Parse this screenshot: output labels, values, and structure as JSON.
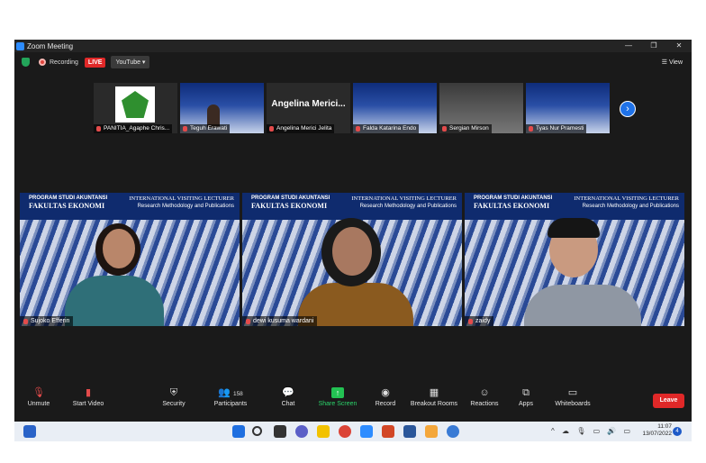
{
  "window": {
    "title": "Zoom Meeting",
    "minimize": "—",
    "restore": "❐",
    "close": "✕"
  },
  "status": {
    "recording": "Recording",
    "live": "LIVE",
    "stream": "YouTube ▾",
    "view": "View"
  },
  "thumbnails": [
    {
      "name": "PANITIA_Agaphe Chris..."
    },
    {
      "name": "Teguh Erawati"
    },
    {
      "name": "Angelina Merici Jelita",
      "display_name": "Angelina Merici..."
    },
    {
      "name": "Falda Katarina Endo"
    },
    {
      "name": "Sergian Mirson"
    },
    {
      "name": "Tyas Nur Pramesti"
    }
  ],
  "banner": {
    "program": "PROGRAM STUDI AKUNTANSI",
    "faculty": "FAKULTAS EKONOMI",
    "event": "INTERNATIONAL VISITING LECTURER",
    "topic": "Research Methodology and Publications"
  },
  "tiles": [
    {
      "name": "Sujoko Efferin"
    },
    {
      "name": "dewi kusuma wardani"
    },
    {
      "name": "zaidy"
    }
  ],
  "toolbar": {
    "unmute": "Unmute",
    "start_video": "Start Video",
    "security": "Security",
    "participants": "Participants",
    "participants_count": "158",
    "chat": "Chat",
    "share_screen": "Share Screen",
    "record": "Record",
    "breakout": "Breakout Rooms",
    "reactions": "Reactions",
    "apps": "Apps",
    "whiteboards": "Whiteboards",
    "leave": "Leave"
  },
  "taskbar": {
    "time": "11:07",
    "date": "13/07/2022",
    "notifications": "4"
  },
  "colors": {
    "accent": "#2d8cff",
    "leave": "#e02828",
    "share": "#23c253",
    "active_outline": "#c8e650"
  }
}
